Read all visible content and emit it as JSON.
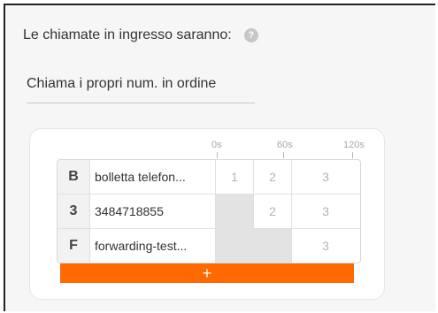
{
  "header": {
    "title": "Le chiamate in ingresso saranno:",
    "help_icon": "?"
  },
  "ring_mode": {
    "value": "Chiama i propri num. in ordine"
  },
  "scale": [
    "0s",
    "60s",
    "120s"
  ],
  "rows": [
    {
      "letter": "B",
      "name": "bolletta telefon...",
      "slots": [
        "1",
        "2",
        "3"
      ]
    },
    {
      "letter": "3",
      "name": "3484718855",
      "slots": [
        "",
        "2",
        "3"
      ]
    },
    {
      "letter": "F",
      "name": "forwarding-test...",
      "slots": [
        "",
        "",
        "3"
      ]
    }
  ],
  "add_button": {
    "label": "+"
  },
  "colors": {
    "accent": "#ff6a00",
    "disabled_cell": "#e3e3e3"
  }
}
